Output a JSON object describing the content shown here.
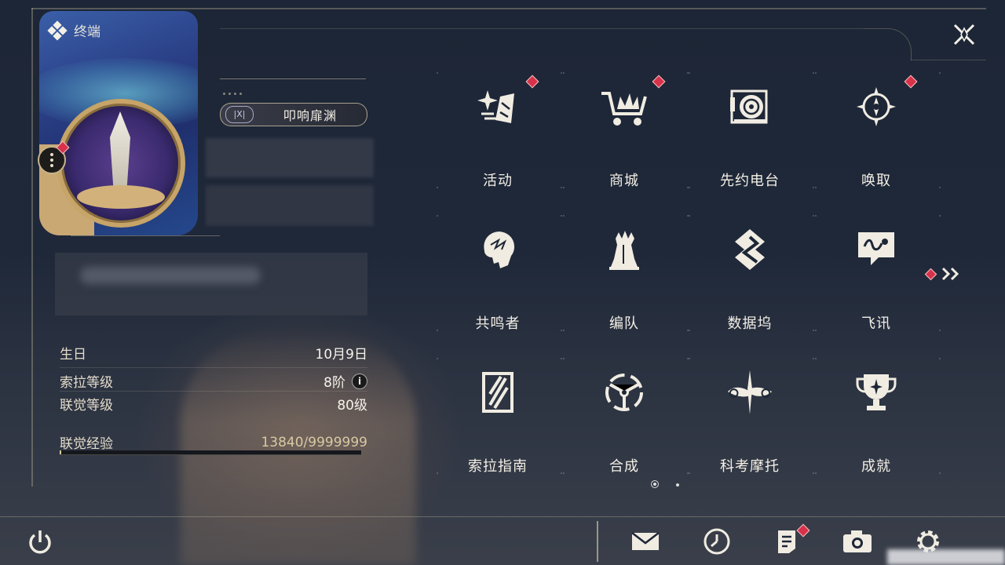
{
  "header": {
    "title": "终端"
  },
  "profile": {
    "title_badge": "叩响扉渊",
    "birthday_label": "生日",
    "birthday_value": "10月9日",
    "sola_level_label": "索拉等级",
    "sola_level_value": "8阶",
    "union_level_label": "联觉等级",
    "union_level_value": "80级",
    "union_exp_label": "联觉经验",
    "union_exp_value": "13840/9999999",
    "union_exp_progress": 0.0014
  },
  "menu": [
    {
      "label": "活动",
      "icon": "sparkle-icon",
      "badge": true
    },
    {
      "label": "商城",
      "icon": "shop-cart-icon",
      "badge": true
    },
    {
      "label": "先约电台",
      "icon": "radio-icon",
      "badge": false
    },
    {
      "label": "唤取",
      "icon": "compass-star-icon",
      "badge": true
    },
    {
      "label": "共鸣者",
      "icon": "resonator-head-icon",
      "badge": false
    },
    {
      "label": "编队",
      "icon": "chess-team-icon",
      "badge": false
    },
    {
      "label": "数据坞",
      "icon": "data-dock-icon",
      "badge": false
    },
    {
      "label": "飞讯",
      "icon": "chat-message-icon",
      "badge": false
    },
    {
      "label": "索拉指南",
      "icon": "guide-book-icon",
      "badge": false
    },
    {
      "label": "合成",
      "icon": "synthesis-icon",
      "badge": false
    },
    {
      "label": "科考摩托",
      "icon": "motorbike-icon",
      "badge": false
    },
    {
      "label": "成就",
      "icon": "trophy-icon",
      "badge": false
    }
  ],
  "pagination": {
    "pages": 2,
    "current": 1
  },
  "bottom_bar": [
    {
      "icon": "mail-icon",
      "badge": false
    },
    {
      "icon": "clock-icon",
      "badge": false
    },
    {
      "icon": "notice-icon",
      "badge": true
    },
    {
      "icon": "camera-icon",
      "badge": false
    },
    {
      "icon": "settings-gear-icon",
      "badge": false
    }
  ],
  "colors": {
    "badge": "#d8324a",
    "text": "#f3efe6",
    "accent_gold": "#c7a467"
  }
}
